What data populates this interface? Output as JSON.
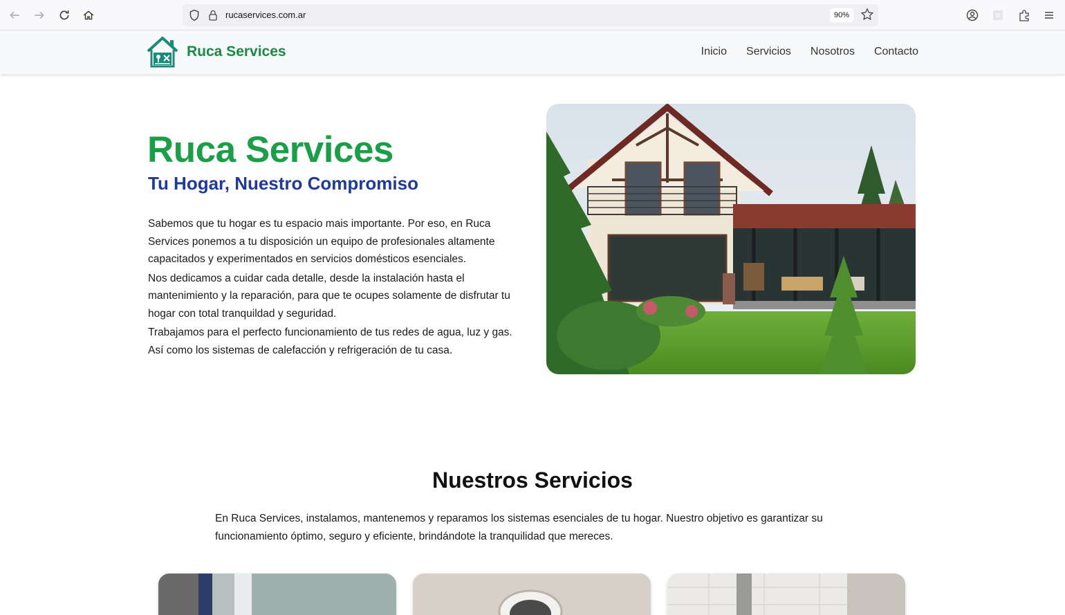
{
  "browser": {
    "url": "rucaservices.com.ar",
    "zoom": "90%"
  },
  "header": {
    "brand_name": "Ruca Services",
    "nav": [
      "Inicio",
      "Servicios",
      "Nosotros",
      "Contacto"
    ]
  },
  "hero": {
    "title": "Ruca Services",
    "subtitle": "Tu Hogar, Nuestro Compromiso",
    "paragraphs": [
      "Sabemos que tu hogar es tu espacio mais importante. Por eso, en Ruca Services ponemos a tu disposición un equipo de profesionales altamente capacitados y experimentados en servicios domésticos esenciales.",
      "Nos dedicamos a cuidar cada detalle, desde la instalación hasta el mantenimiento y la reparación, para que te ocupes solamente de disfrutar tu hogar con total tranquildad y seguridad.",
      "Trabajamos para el perfecto funcionamiento de tus redes de agua, luz y gas. Así como los sistemas de calefacción y refrigeración de tu casa."
    ]
  },
  "services": {
    "title": "Nuestros Servicios",
    "description": "En Ruca Services, instalamos, mantenemos y reparamos los sistemas esenciales de tu hogar. Nuestro objetivo es garantizar su funcionamiento óptimo, seguro y eficiente, brindándote la tranquilidad que mereces."
  },
  "colors": {
    "brand_green": "#1a9e48",
    "subtitle_blue": "#1d3a9c"
  },
  "icons": [
    "back-icon",
    "forward-icon",
    "reload-icon",
    "home-icon",
    "shield-icon",
    "lock-icon",
    "star-icon",
    "account-icon",
    "extension-icon",
    "puzzle-icon",
    "menu-icon",
    "house-logo-icon"
  ]
}
